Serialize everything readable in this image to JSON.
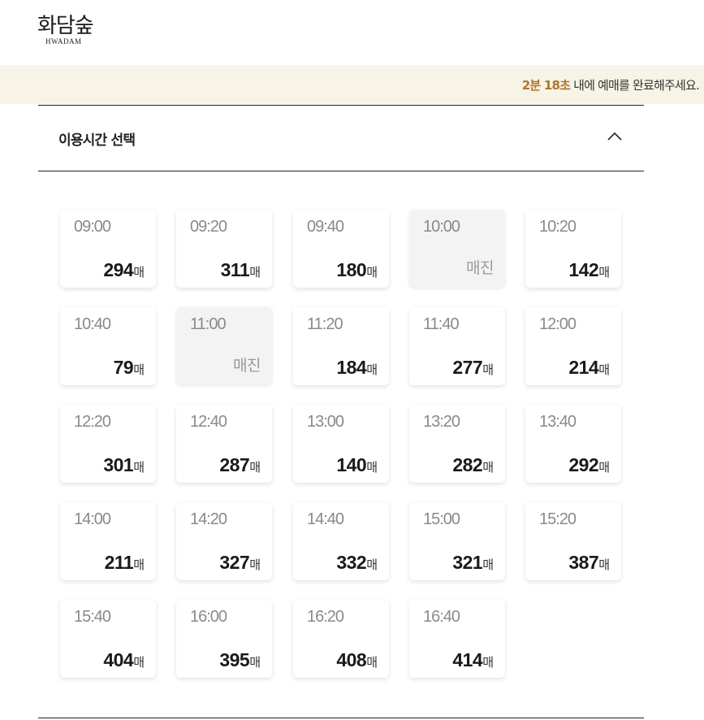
{
  "logo": {
    "korean": "화담숲",
    "english": "HWADAM"
  },
  "timer": {
    "highlight": "2분 18초",
    "message": " 내에 예매를 완료해주세요."
  },
  "section": {
    "title": "이용시간 선택"
  },
  "unit_label": "매",
  "sold_out_label": "매진",
  "slots": [
    {
      "time": "09:00",
      "count": "294",
      "sold_out": false
    },
    {
      "time": "09:20",
      "count": "311",
      "sold_out": false
    },
    {
      "time": "09:40",
      "count": "180",
      "sold_out": false
    },
    {
      "time": "10:00",
      "count": "",
      "sold_out": true
    },
    {
      "time": "10:20",
      "count": "142",
      "sold_out": false
    },
    {
      "time": "10:40",
      "count": "79",
      "sold_out": false
    },
    {
      "time": "11:00",
      "count": "",
      "sold_out": true
    },
    {
      "time": "11:20",
      "count": "184",
      "sold_out": false
    },
    {
      "time": "11:40",
      "count": "277",
      "sold_out": false
    },
    {
      "time": "12:00",
      "count": "214",
      "sold_out": false
    },
    {
      "time": "12:20",
      "count": "301",
      "sold_out": false
    },
    {
      "time": "12:40",
      "count": "287",
      "sold_out": false
    },
    {
      "time": "13:00",
      "count": "140",
      "sold_out": false
    },
    {
      "time": "13:20",
      "count": "282",
      "sold_out": false
    },
    {
      "time": "13:40",
      "count": "292",
      "sold_out": false
    },
    {
      "time": "14:00",
      "count": "211",
      "sold_out": false
    },
    {
      "time": "14:20",
      "count": "327",
      "sold_out": false
    },
    {
      "time": "14:40",
      "count": "332",
      "sold_out": false
    },
    {
      "time": "15:00",
      "count": "321",
      "sold_out": false
    },
    {
      "time": "15:20",
      "count": "387",
      "sold_out": false
    },
    {
      "time": "15:40",
      "count": "404",
      "sold_out": false
    },
    {
      "time": "16:00",
      "count": "395",
      "sold_out": false
    },
    {
      "time": "16:20",
      "count": "408",
      "sold_out": false
    },
    {
      "time": "16:40",
      "count": "414",
      "sold_out": false
    }
  ]
}
